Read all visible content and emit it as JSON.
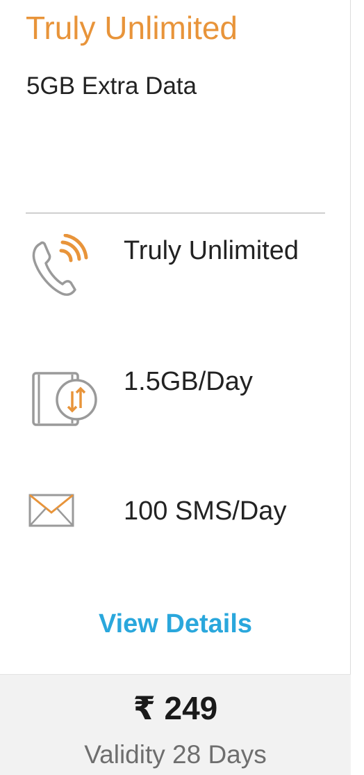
{
  "plan": {
    "title": "Truly Unlimited",
    "subtitle": "5GB Extra Data"
  },
  "benefits": [
    {
      "icon": "phone-call-icon",
      "text": "Truly Unlimited"
    },
    {
      "icon": "mobile-data-icon",
      "text": "1.5GB/Day"
    },
    {
      "icon": "envelope-icon",
      "text": "100 SMS/Day"
    }
  ],
  "view_details_label": "View Details",
  "footer": {
    "price": "₹ 249",
    "validity": "Validity 28 Days"
  },
  "colors": {
    "accent_orange": "#e8943a",
    "link_blue": "#2aa7dc",
    "footer_bg": "#f2f2f2",
    "icon_gray": "#9a9a9a"
  }
}
